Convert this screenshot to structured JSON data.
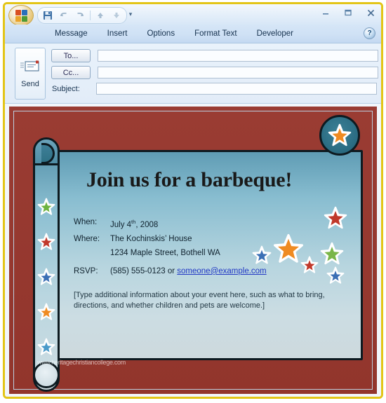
{
  "window": {
    "office_orb": "office-logo",
    "quick_access": [
      {
        "name": "save-icon",
        "label": "Save"
      },
      {
        "name": "undo-icon",
        "label": "Undo"
      },
      {
        "name": "redo-icon",
        "label": "Redo"
      },
      {
        "name": "previous-item-icon",
        "label": "Previous Item"
      },
      {
        "name": "next-item-icon",
        "label": "Next Item"
      }
    ],
    "qat_more": "▾",
    "controls": {
      "minimize": "–",
      "maximize": "▭",
      "close": "✕"
    }
  },
  "ribbon": {
    "tabs": [
      {
        "label": "Message"
      },
      {
        "label": "Insert"
      },
      {
        "label": "Options"
      },
      {
        "label": "Format Text"
      },
      {
        "label": "Developer"
      }
    ],
    "help_label": "?"
  },
  "compose": {
    "send_label": "Send",
    "to_label": "To...",
    "to_value": "",
    "cc_label": "Cc...",
    "cc_value": "",
    "subject_label": "Subject:",
    "subject_value": ""
  },
  "invitation": {
    "title": "Join us for a barbeque!",
    "when_label": "When:",
    "when_value_pre": "July 4",
    "when_value_sup": "th",
    "when_value_post": ", 2008",
    "where_label": "Where:",
    "where_value_line1": "The Kochinskis’ House",
    "where_value_line2": "1234 Maple Street, Bothell WA",
    "rsvp_label": "RSVP:",
    "rsvp_phone": "(585) 555-0123 or ",
    "rsvp_email": "someone@example.com",
    "placeholder_text": "[Type additional information about your event here, such as what to bring, directions, and whether children and pets are welcome.]",
    "watermark": "www.heritagechristiancollege.com",
    "colors": {
      "background_red": "#96382f",
      "panel_top": "#5f9cb4",
      "panel_bottom": "#cdd9dd",
      "link_blue": "#2138c4",
      "frame_yellow": "#e3c517"
    },
    "band_stars": [
      {
        "name": "star-green",
        "color": "#6db33f"
      },
      {
        "name": "star-red",
        "color": "#c0392b"
      },
      {
        "name": "star-blue",
        "color": "#3b6fb5"
      },
      {
        "name": "star-orange",
        "color": "#ef8b22"
      },
      {
        "name": "star-lightblue",
        "color": "#4a9ac9"
      }
    ],
    "cluster_stars": [
      {
        "name": "star-red-large",
        "color": "#c0392b"
      },
      {
        "name": "star-orange-large",
        "color": "#ef8b22"
      },
      {
        "name": "star-green-medium",
        "color": "#7ab648"
      },
      {
        "name": "star-blue-small",
        "color": "#3b6fb5"
      },
      {
        "name": "star-red-small",
        "color": "#c0392b"
      },
      {
        "name": "star-blue-bottom",
        "color": "#3b6fb5"
      }
    ],
    "curl_star": {
      "name": "star-orange-curl",
      "color": "#ef8b22"
    }
  }
}
